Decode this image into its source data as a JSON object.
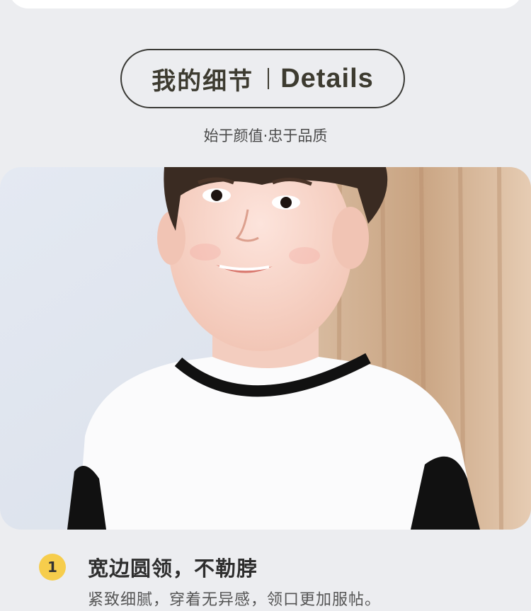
{
  "header": {
    "title_zh": "我的细节",
    "title_en": "Details"
  },
  "tagline": "始于颜值·忠于品质",
  "photo": {
    "subject": "boy-wearing-white-tshirt-with-black-collar"
  },
  "feature": {
    "number": "1",
    "title": "宽边圆领，不勒脖",
    "description": "紧致细腻，穿着无异感，领口更加服帖。"
  },
  "colors": {
    "background": "#ecedf0",
    "accent": "#f6cd4c",
    "text": "#3d3b30"
  }
}
